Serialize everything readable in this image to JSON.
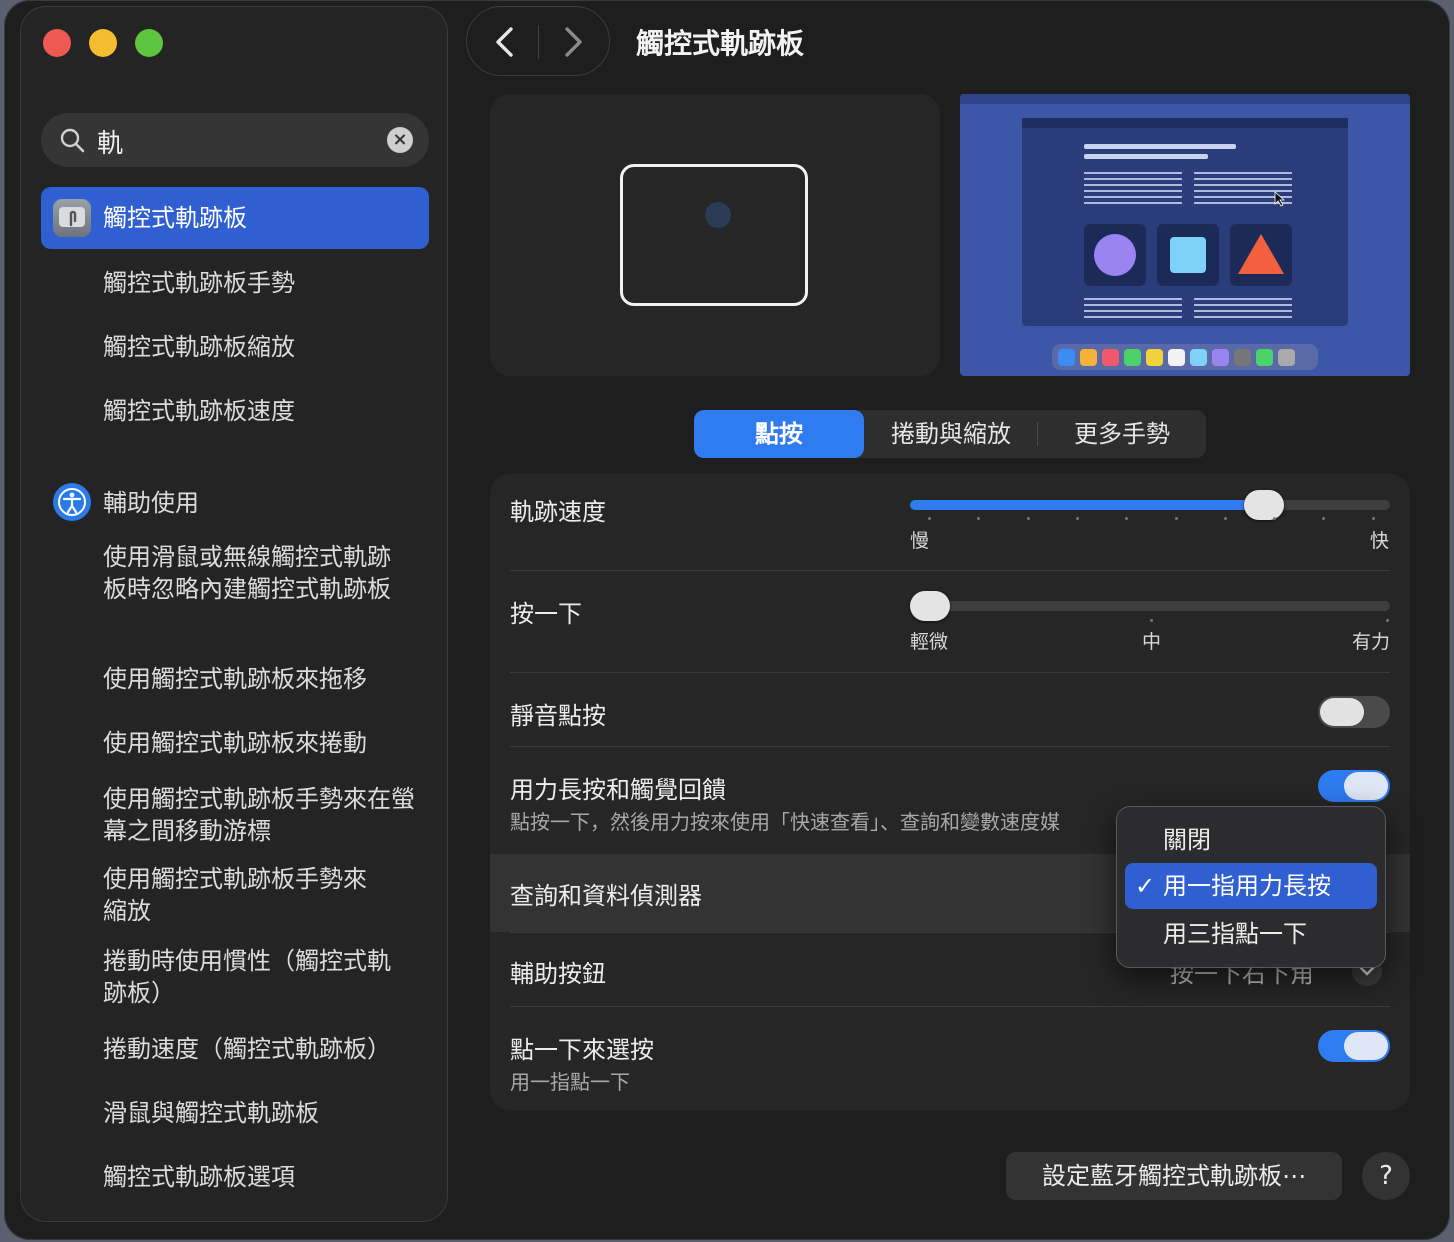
{
  "window": {
    "title": "觸控式軌跡板"
  },
  "search": {
    "query": "軌",
    "clear_icon": "xmark-circle-icon"
  },
  "sidebar": {
    "items": [
      {
        "label": "觸控式軌跡板",
        "icon": "trackpad-icon",
        "selected": true
      },
      {
        "label": "觸控式軌跡板手勢"
      },
      {
        "label": "觸控式軌跡板縮放"
      },
      {
        "label": "觸控式軌跡板速度"
      },
      {
        "label": "輔助使用",
        "icon": "accessibility-icon"
      },
      {
        "label": "使用滑鼠或無線觸控式軌跡板時忽略內建觸控式軌跡板"
      },
      {
        "label": "使用觸控式軌跡板來拖移"
      },
      {
        "label": "使用觸控式軌跡板來捲動"
      },
      {
        "label": "使用觸控式軌跡板手勢來在螢幕之間移動游標"
      },
      {
        "label": "使用觸控式軌跡板手勢來縮放"
      },
      {
        "label": "捲動時使用慣性（觸控式軌跡板）"
      },
      {
        "label": "捲動速度（觸控式軌跡板）"
      },
      {
        "label": "滑鼠與觸控式軌跡板"
      },
      {
        "label": "觸控式軌跡板選項"
      }
    ]
  },
  "tabs": [
    {
      "label": "點按",
      "active": true
    },
    {
      "label": "捲動與縮放"
    },
    {
      "label": "更多手勢"
    }
  ],
  "settings": {
    "tracking_speed": {
      "label": "軌跡速度",
      "min_label": "慢",
      "max_label": "快",
      "value": 0.76
    },
    "click": {
      "label": "按一下",
      "min_label": "輕微",
      "mid_label": "中",
      "max_label": "有力",
      "value": 0.0
    },
    "silent_click": {
      "label": "靜音點按",
      "on": false
    },
    "force_click": {
      "label": "用力長按和觸覺回饋",
      "description": "點按一下，然後用力按來使用「快速查看」、查詢和變數速度媒",
      "on": true
    },
    "lookup": {
      "label": "查詢和資料偵測器"
    },
    "secondary_click": {
      "label": "輔助按鈕",
      "value": "按一下右下角"
    },
    "tap_to_click": {
      "label": "點一下來選按",
      "description": "用一指點一下",
      "on": true
    }
  },
  "popup_menu": {
    "options": [
      "關閉",
      "用一指用力長按",
      "用三指點一下"
    ],
    "selected_index": 1,
    "check": "✓"
  },
  "footer": {
    "bluetooth_button": "設定藍牙觸控式軌跡板⋯",
    "help": "?"
  },
  "colors": {
    "accent": "#2f7bf0",
    "selection": "#2f5fd0"
  }
}
